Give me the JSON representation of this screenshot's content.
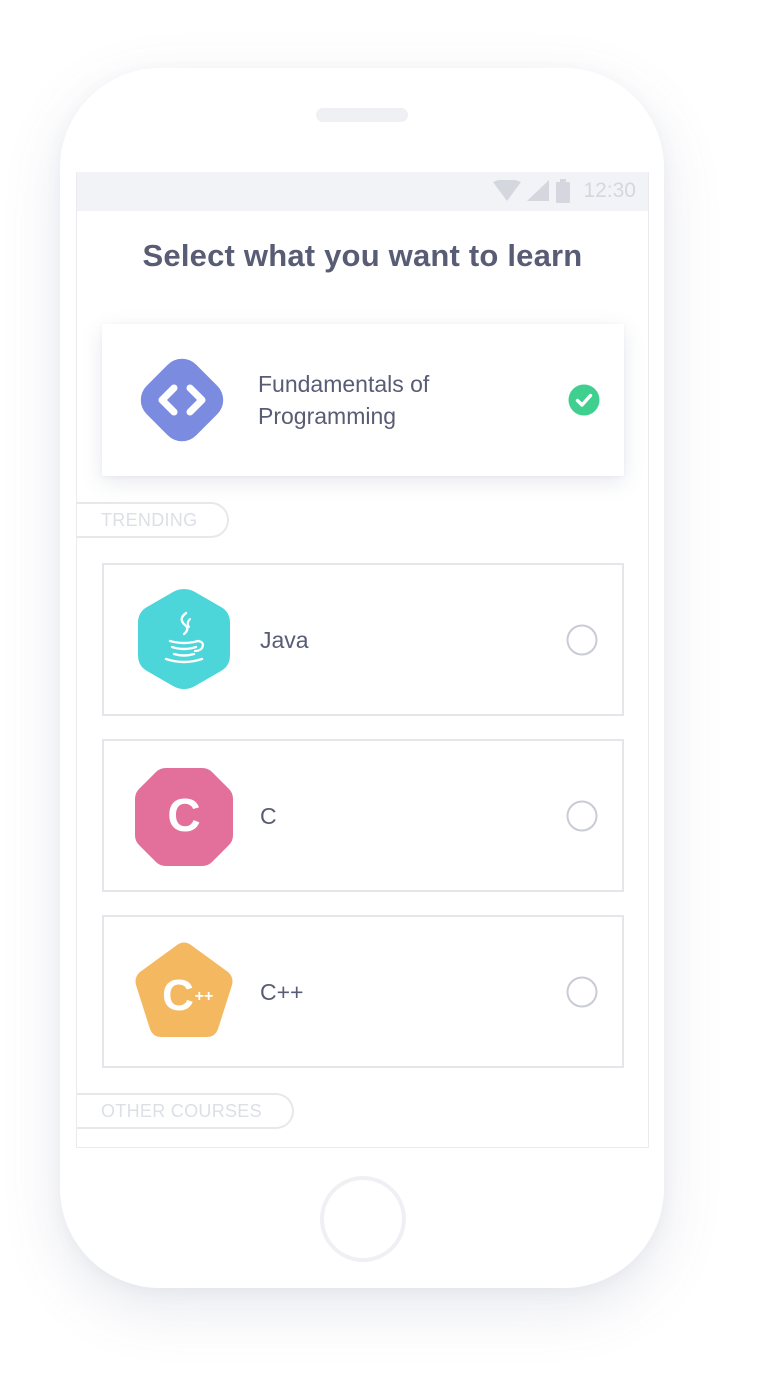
{
  "status_bar": {
    "time": "12:30"
  },
  "title": "Select what you want to learn",
  "featured": {
    "label_line1": "Fundamentals of",
    "label_line2": "Programming",
    "selected": true,
    "icon": "code-brackets-icon",
    "color": "#7b8be0"
  },
  "sections": {
    "trending": "TRENDING",
    "other": "OTHER COURSES"
  },
  "courses": [
    {
      "label": "Java",
      "icon": "java-cup-icon",
      "color": "#4cd6da",
      "selected": false
    },
    {
      "label": "C",
      "icon": "c-letter-icon",
      "color": "#e2709a",
      "selected": false
    },
    {
      "label": "C++",
      "icon": "cpp-letter-icon",
      "color": "#f4b860",
      "selected": false
    }
  ],
  "colors": {
    "check": "#3fcf8e",
    "text": "#585c74"
  }
}
